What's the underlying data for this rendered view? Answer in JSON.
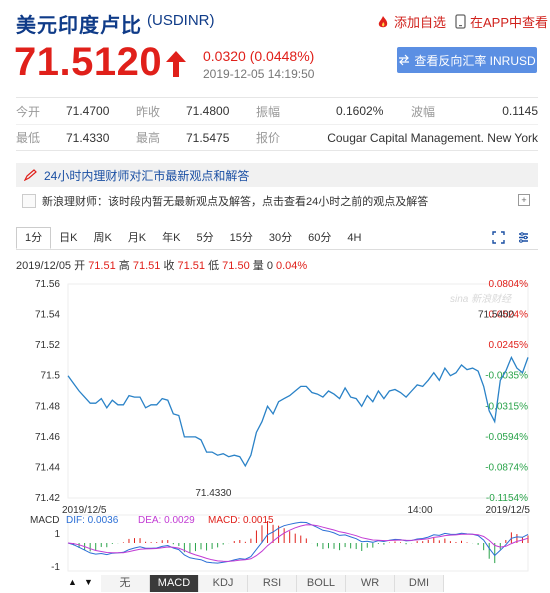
{
  "header": {
    "title": "美元印度卢比",
    "code": "(USDINR)",
    "add_fav": "添加自选",
    "open_app": "在APP中查看"
  },
  "quote": {
    "price": "71.5120",
    "change": "0.0320 (0.0448%)",
    "datetime": "2019-12-05 14:19:50",
    "reverse_button": "查看反向汇率 INRUSD"
  },
  "stats": {
    "row1": [
      {
        "label": "今开",
        "value": "71.4700"
      },
      {
        "label": "昨收",
        "value": "71.4800"
      },
      {
        "label": "振幅",
        "value": "0.1602%"
      },
      {
        "label": "波幅",
        "value": "0.1145"
      }
    ],
    "row2": [
      {
        "label": "最低",
        "value": "71.4330"
      },
      {
        "label": "最高",
        "value": "71.5475"
      },
      {
        "label": "报价",
        "value": "Cougar Capital Management. New York"
      }
    ]
  },
  "news": {
    "heading": "24小时内理财师对汇市最新观点和解答",
    "item": "新浪理财师：该时段内暂无最新观点及解答，点击查看24小时之前的观点及解答",
    "expand": "+"
  },
  "tabs": [
    "1分",
    "日K",
    "周K",
    "月K",
    "年K",
    "5分",
    "15分",
    "30分",
    "60分",
    "4H"
  ],
  "ohlc": {
    "date": "2019/12/05",
    "open_label": "开",
    "open": "71.51",
    "high_label": "高",
    "high": "71.51",
    "close_label": "收",
    "close": "71.51",
    "low_label": "低",
    "low": "71.50",
    "vol_label": "量",
    "vol": "0",
    "pct": "0.04%"
  },
  "chart_data": {
    "type": "line",
    "y_ticks": [
      "71.56",
      "71.54",
      "71.52",
      "71.5",
      "71.48",
      "71.46",
      "71.44",
      "71.42"
    ],
    "pct_ticks": [
      "0.0804%",
      "0.0524%",
      "0.0245%",
      "-0.0035%",
      "-0.0315%",
      "-0.0594%",
      "-0.0874%",
      "-0.1154%"
    ],
    "ylim": [
      71.42,
      71.56
    ],
    "x_labels": [
      "2019/12/5",
      "14:00",
      "2019/12/5"
    ],
    "high_label": "71.5400",
    "low_label": "71.4330",
    "watermark": "sina 新浪财经",
    "series": [
      {
        "values": [
          71.5,
          71.495,
          71.49,
          71.486,
          71.482,
          71.482,
          71.485,
          71.479,
          71.484,
          71.481,
          71.481,
          71.487,
          71.486,
          71.486,
          71.479,
          71.481,
          71.481,
          71.485,
          71.484,
          71.475,
          71.474,
          71.46,
          71.46,
          71.46,
          71.458,
          71.45,
          71.45,
          71.448,
          71.449,
          71.447,
          71.448,
          71.447,
          71.441,
          71.448,
          71.463,
          71.47,
          71.48,
          71.475,
          71.483,
          71.485,
          71.487,
          71.49,
          71.493,
          71.493,
          71.489,
          71.488,
          71.486,
          71.49,
          71.488,
          71.485,
          71.492,
          71.486,
          71.485,
          71.48,
          71.487,
          71.483,
          71.49,
          71.485,
          71.49,
          71.491,
          71.489,
          71.486,
          71.49,
          71.494,
          71.493,
          71.497,
          71.502,
          71.497,
          71.505,
          71.5,
          71.502,
          71.507,
          71.504,
          71.505,
          71.503,
          71.493,
          71.477,
          71.47,
          71.497,
          71.503,
          71.512,
          71.505,
          71.502,
          71.512
        ]
      }
    ]
  },
  "macd": {
    "label": "MACD",
    "dif": "DIF: 0.0036",
    "dea": "DEA: 0.0029",
    "macd": "MACD: 0.0015",
    "y_top": "1",
    "y_bottom": "-1",
    "colors": {
      "dif": "#2b6fd6",
      "dea": "#c23bd4",
      "pos": "#e0201a",
      "neg": "#2aa34a"
    }
  },
  "indicator_tabs": [
    "无",
    "MACD",
    "KDJ",
    "RSI",
    "BOLL",
    "WR",
    "DMI"
  ],
  "colors": {
    "line": "#2a82c7",
    "up": "#e0201a",
    "down": "#2aa34a",
    "brand": "#0f3b88"
  }
}
